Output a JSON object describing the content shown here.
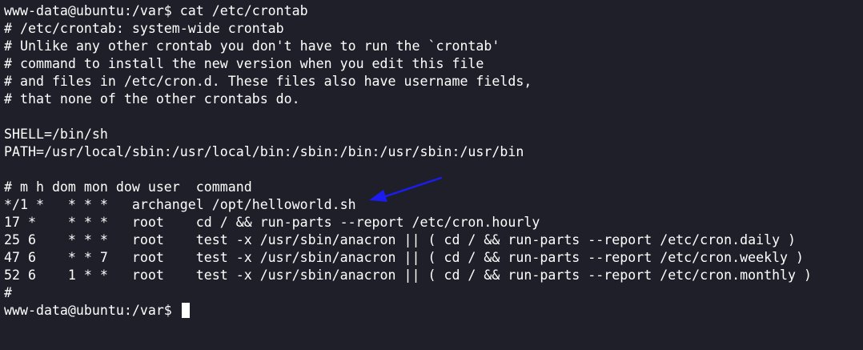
{
  "terminal": {
    "lines": [
      "www-data@ubuntu:/var$ cat /etc/crontab",
      "# /etc/crontab: system-wide crontab",
      "# Unlike any other crontab you don't have to run the `crontab'",
      "# command to install the new version when you edit this file",
      "# and files in /etc/cron.d. These files also have username fields,",
      "# that none of the other crontabs do.",
      "",
      "SHELL=/bin/sh",
      "PATH=/usr/local/sbin:/usr/local/bin:/sbin:/bin:/usr/sbin:/usr/bin",
      "",
      "# m h dom mon dow user  command",
      "*/1 *   * * *   archangel /opt/helloworld.sh",
      "17 *    * * *   root    cd / && run-parts --report /etc/cron.hourly",
      "25 6    * * *   root    test -x /usr/sbin/anacron || ( cd / && run-parts --report /etc/cron.daily )",
      "47 6    * * 7   root    test -x /usr/sbin/anacron || ( cd / && run-parts --report /etc/cron.weekly )",
      "52 6    1 * *   root    test -x /usr/sbin/anacron || ( cd / && run-parts --report /etc/cron.monthly )",
      "#"
    ],
    "prompt": "www-data@ubuntu:/var$ ",
    "text_color": "#ffffff",
    "background_color": "#1e1f29",
    "arrow_color": "#1c1cf0"
  }
}
